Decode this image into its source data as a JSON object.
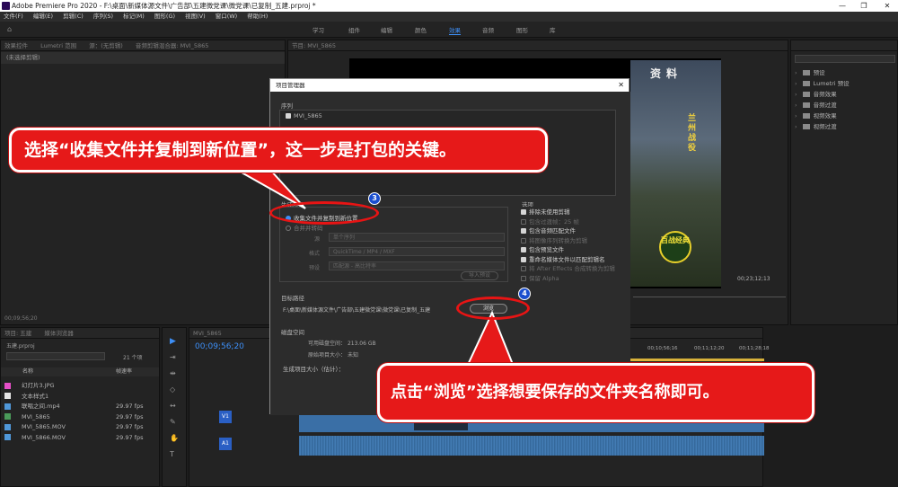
{
  "titlebar": {
    "title": "Adobe Premiere Pro 2020 - F:\\桌面\\新媒体源文件\\广告部\\五建微党课\\微党课\\已复制_五建.prproj *",
    "min": "—",
    "max": "❐",
    "close": "✕"
  },
  "menu": [
    "文件(F)",
    "编辑(E)",
    "剪辑(C)",
    "序列(S)",
    "标记(M)",
    "图形(G)",
    "视图(V)",
    "窗口(W)",
    "帮助(H)"
  ],
  "workspaces": [
    "学习",
    "组件",
    "编辑",
    "颜色",
    "效果",
    "音频",
    "图形",
    "库"
  ],
  "workspace_active_index": 4,
  "source_panel": {
    "tabs": [
      "效果控件",
      "Lumetri 范围",
      "源：(无剪辑)",
      "音频剪辑混合器: MVI_5865"
    ],
    "note": "(未选择剪辑)",
    "timecode": "00;09;56;20"
  },
  "program_panel": {
    "tab": "节目: MVI_5865",
    "timecode": "00;23;12;13",
    "video_text": {
      "title": "资料",
      "vertical": "兰州战役",
      "badge": "百战经典"
    }
  },
  "effects_panel": {
    "items": [
      "预设",
      "Lumetri 预设",
      "音频效果",
      "音频过渡",
      "视频效果",
      "视频过渡"
    ]
  },
  "project_panel": {
    "tab1": "项目: 五建",
    "tab2": "媒体浏览器",
    "file": "五建.prproj",
    "count": "21 个项",
    "headers": {
      "name": "名称",
      "fps": "帧速率"
    },
    "items": [
      {
        "name": "幻灯片3.JPG",
        "fps": "",
        "color": "#e64fc8"
      },
      {
        "name": "文本样式1",
        "fps": "",
        "color": "#e4e4e4"
      },
      {
        "name": "联唱之间.mp4",
        "fps": "29.97 fps",
        "color": "#4f97d8"
      },
      {
        "name": "MVI_5865",
        "fps": "29.97 fps",
        "color": "#4a9a5a"
      },
      {
        "name": "MVI_5865.MOV",
        "fps": "29.97 fps",
        "color": "#4f97d8"
      },
      {
        "name": "MVI_5866.MOV",
        "fps": "29.97 fps",
        "color": "#4f97d8"
      }
    ]
  },
  "timeline": {
    "tab": "MVI_5865",
    "timecode": "00;09;56;20",
    "ruler": [
      "00;10;56;16",
      "00;11;12;20",
      "00;11;28;18"
    ],
    "tracks": [
      "V1",
      "A1"
    ]
  },
  "dialog": {
    "title": "项目管理器",
    "close": "✕",
    "sequence_label": "序列",
    "sequence_item": "MVI_5865",
    "resulting_label": "生成项目",
    "option_copy": "收集文件并复制到新位置",
    "option_transcode": "合并并转码",
    "source_label": "源",
    "source_value": "单个序列",
    "format_label": "格式",
    "format_value": "QuickTime / MP4 / MXF",
    "preset_label": "预设",
    "preset_value": "匹配源 - 高比特率",
    "import_preset": "导入预设",
    "options_label": "选项",
    "options": [
      {
        "label": "排除未使用剪辑",
        "checked": true,
        "enabled": true
      },
      {
        "label": "包含过渡帧：25 帧",
        "checked": false,
        "enabled": false
      },
      {
        "label": "包含音频匹配文件",
        "checked": true,
        "enabled": true
      },
      {
        "label": "将图像序列转换为剪辑",
        "checked": false,
        "enabled": false
      },
      {
        "label": "包含预览文件",
        "checked": true,
        "enabled": true
      },
      {
        "label": "重命名媒体文件以匹配剪辑名",
        "checked": true,
        "enabled": true
      },
      {
        "label": "将 After Effects 合成转换为剪辑",
        "checked": false,
        "enabled": false
      },
      {
        "label": "保留 Alpha",
        "checked": false,
        "enabled": false
      }
    ],
    "dest_label": "目标路径",
    "dest_path": "F:\\桌面\\新媒体源文件\\广告部\\五建微党课\\微党课\\已复制_五建",
    "browse": "浏览",
    "disk_label": "磁盘空间",
    "available_label": "可用磁盘空间：",
    "available_value": "213.06 GB",
    "size_label": "原始项目大小：",
    "size_value": "未知",
    "calc_label": "生成项目大小（估计）："
  },
  "callouts": {
    "top": "选择“收集文件并复制到新位置”，这一步是打包的关键。",
    "bottom": "点击“浏览”选择想要保存的文件夹名称即可。",
    "n3": "3",
    "n4": "4"
  },
  "colors": {
    "accent": "#3d8ff7",
    "callout": "#e61919",
    "badge": "#1a4ecf",
    "clip_video": "#3a6fa6",
    "clip_audio": "#2e5f8f"
  }
}
